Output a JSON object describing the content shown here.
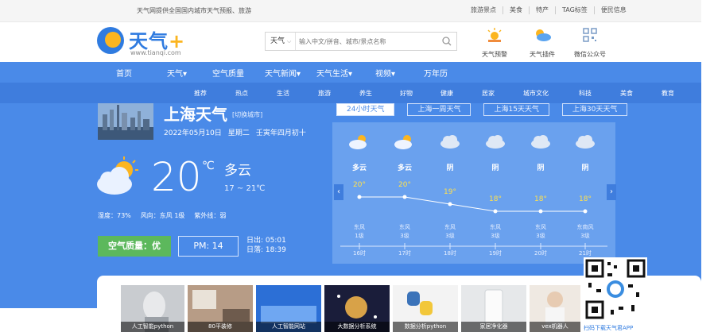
{
  "topbar": {
    "intro": "天气网提供全国国内城市天气预报、旅游",
    "links": [
      "旅游景点",
      "美食",
      "特产",
      "TAG标签",
      "便民信息"
    ]
  },
  "header": {
    "logo_text": "天气",
    "logo_plus": "+",
    "logo_url": "www.tianqi.com",
    "search_select": "天气",
    "search_placeholder": "输入中文/拼音、城市/景点名称",
    "tools": [
      "天气预警",
      "天气插件",
      "微信公众号"
    ]
  },
  "nav": {
    "items": [
      "首页",
      "天气",
      "空气质量",
      "天气新闻",
      "天气生活",
      "视频",
      "万年历"
    ],
    "dropdown_marks": [
      "",
      "▾",
      "",
      "▾",
      "▾",
      "▾",
      ""
    ]
  },
  "subnav": {
    "items": [
      "推荐",
      "热点",
      "生活",
      "旅游",
      "养生",
      "好物",
      "健康",
      "居家",
      "城市文化",
      "科技",
      "美食",
      "教育"
    ]
  },
  "current": {
    "city": "上海天气",
    "switch_label": "[切换城市]",
    "date": "2022年05月10日",
    "weekday": "星期二",
    "lunar": "壬寅年四月初十",
    "temp": "20",
    "unit": "℃",
    "condition": "多云",
    "range": "17 ~ 21℃",
    "humidity": "湿度：73%",
    "wind": "风向：东风 1级",
    "uv": "紫外线：弱",
    "aqi": "空气质量：优",
    "pm": "PM: 14",
    "sunrise": "日出: 05:01",
    "sunset": "日落: 18:39"
  },
  "forecast": {
    "tabs": [
      "24小时天气",
      "上海一周天气",
      "上海15天天气",
      "上海30天天气"
    ],
    "active_tab": 0,
    "hours": [
      {
        "cond": "多云",
        "icon": "partly-cloudy-icon",
        "temp": "20°",
        "temp_value": 20,
        "wind": "东风",
        "level": "1级",
        "time": "16时"
      },
      {
        "cond": "多云",
        "icon": "partly-cloudy-icon",
        "temp": "20°",
        "temp_value": 20,
        "wind": "东风",
        "level": "3级",
        "time": "17时"
      },
      {
        "cond": "阴",
        "icon": "cloud-icon",
        "temp": "19°",
        "temp_value": 19,
        "wind": "东风",
        "level": "3级",
        "time": "18时"
      },
      {
        "cond": "阴",
        "icon": "cloud-icon",
        "temp": "18°",
        "temp_value": 18,
        "wind": "东风",
        "level": "3级",
        "time": "19时"
      },
      {
        "cond": "阴",
        "icon": "cloud-icon",
        "temp": "18°",
        "temp_value": 18,
        "wind": "东风",
        "level": "3级",
        "time": "20时"
      },
      {
        "cond": "阴",
        "icon": "cloud-icon",
        "temp": "18°",
        "temp_value": 18,
        "wind": "东南风",
        "level": "3级",
        "time": "21时"
      }
    ]
  },
  "news": {
    "items": [
      "人工智能python",
      "80平装修",
      "人工智能网站",
      "大数据分析系统",
      "数据分析python",
      "家居净化器",
      "vex机器人"
    ]
  },
  "promo": {
    "qr_caption": "扫码下载天气君APP"
  },
  "colors": {
    "brand_blue": "#4a8ae8",
    "aqi_green": "#5cb85c",
    "temp_yellow": "#ffe14d"
  }
}
